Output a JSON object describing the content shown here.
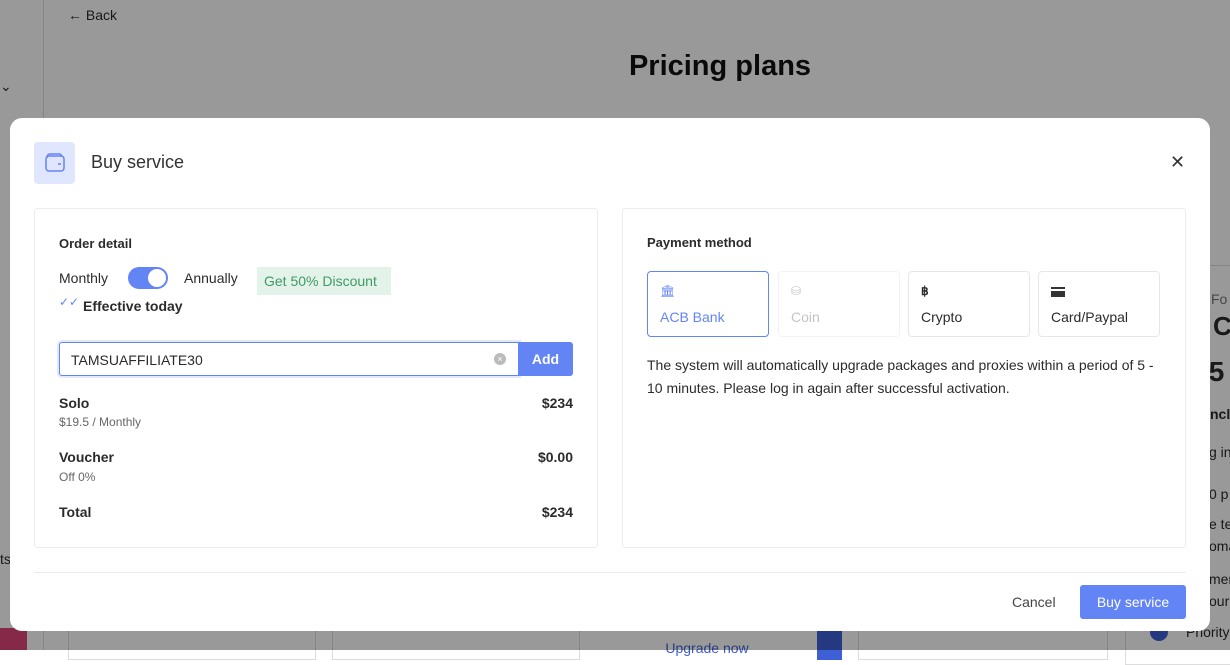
{
  "background": {
    "back_label": "Back",
    "page_title": "Pricing plans",
    "upgrade_label": "Upgrade now",
    "side_fragments": [
      "Fo",
      "C",
      ".5",
      "nclu",
      "g in",
      "0 p",
      "e te",
      "oma",
      "mer",
      "our",
      "Priority"
    ],
    "left_fragment": "ts"
  },
  "modal": {
    "title": "Buy service",
    "icon": "wallet-icon",
    "order": {
      "heading": "Order detail",
      "monthly": "Monthly",
      "annually": "Annually",
      "toggle_on": true,
      "discount_badge": "Get 50% Discount",
      "effective": "Effective today",
      "voucher_value": "TAMSUAFFILIATE30",
      "add_label": "Add",
      "rows": [
        {
          "label": "Solo",
          "sub": "$19.5 / Monthly",
          "value": "$234"
        },
        {
          "label": "Voucher",
          "sub": "Off 0%",
          "value": "$0.00"
        },
        {
          "label": "Total",
          "value": "$234"
        }
      ]
    },
    "payment": {
      "heading": "Payment method",
      "methods": [
        {
          "label": "ACB Bank",
          "icon": "bank-icon",
          "state": "selected"
        },
        {
          "label": "Coin",
          "icon": "coins-icon",
          "state": "disabled"
        },
        {
          "label": "Crypto",
          "icon": "bitcoin-icon",
          "state": "normal"
        },
        {
          "label": "Card/Paypal",
          "icon": "credit-card-icon",
          "state": "normal"
        }
      ],
      "note": "The system will automatically upgrade packages and proxies within a period of 5 - 10 minutes. Please log in again after successful activation."
    },
    "cancel_label": "Cancel",
    "buy_label": "Buy service"
  },
  "colors": {
    "accent": "#6384f5",
    "badge_bg": "#e3f3ea",
    "badge_text": "#3f9a64"
  }
}
